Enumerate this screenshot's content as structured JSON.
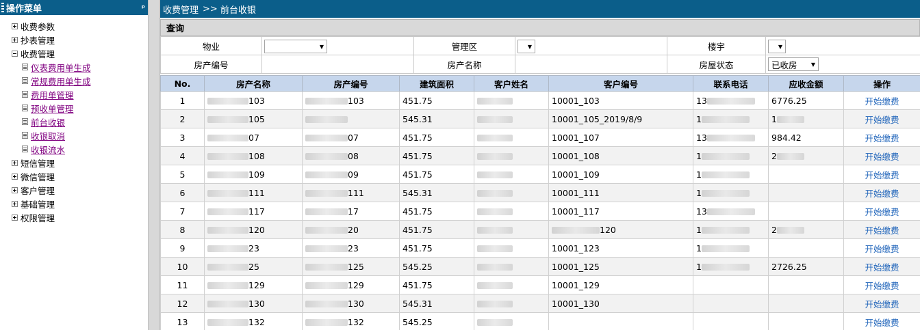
{
  "sidebar": {
    "title": "操作菜单",
    "pin_glyph": "ᵖ",
    "nodes": [
      {
        "label": "收费参数",
        "expanded": false
      },
      {
        "label": "抄表管理",
        "expanded": false
      },
      {
        "label": "收费管理",
        "expanded": true,
        "children": [
          "仪表费用单生成",
          "常规费用单生成",
          "费用单管理",
          "预收单管理",
          "前台收银",
          "收银取消",
          "收银流水"
        ]
      },
      {
        "label": "短信管理",
        "expanded": false
      },
      {
        "label": "微信管理",
        "expanded": false
      },
      {
        "label": "客户管理",
        "expanded": false
      },
      {
        "label": "基础管理",
        "expanded": false
      },
      {
        "label": "权限管理",
        "expanded": false
      }
    ]
  },
  "breadcrumb": {
    "section": "收费管理",
    "separator": ">>",
    "page": "前台收银"
  },
  "query": {
    "title": "查询",
    "labels": {
      "property": "物业",
      "district": "管理区",
      "building": "楼宇",
      "house_code": "房产编号",
      "house_name": "房产名称",
      "house_status": "房屋状态"
    },
    "values": {
      "property": "",
      "district": "",
      "building": "",
      "house_code": "",
      "house_name": "",
      "house_status": "已收房"
    }
  },
  "table": {
    "columns": [
      "No.",
      "房产名称",
      "房产编号",
      "建筑面积",
      "客户姓名",
      "客户编号",
      "联系电话",
      "应收金额",
      "操作"
    ],
    "action_label": "开始缴费",
    "rows": [
      {
        "no": "1",
        "name_suffix": "103",
        "code_suffix": "103",
        "area": "451.75",
        "cust_code": "10001_103",
        "phone_visible": "13",
        "amount": "6776.25"
      },
      {
        "no": "2",
        "name_suffix": "105",
        "code_suffix": "",
        "area": "545.31",
        "cust_code": "10001_105_2019/8/9",
        "phone_visible": "1",
        "amount": "1"
      },
      {
        "no": "3",
        "name_suffix": "07",
        "code_suffix": "07",
        "area": "451.75",
        "cust_code": "10001_107",
        "phone_visible": "13",
        "amount": "984.42"
      },
      {
        "no": "4",
        "name_suffix": "108",
        "code_suffix": "08",
        "area": "451.75",
        "cust_code": "10001_108",
        "phone_visible": "1",
        "amount": "2"
      },
      {
        "no": "5",
        "name_suffix": "109",
        "code_suffix": "09",
        "area": "451.75",
        "cust_code": "10001_109",
        "phone_visible": "1",
        "amount": ""
      },
      {
        "no": "6",
        "name_suffix": "111",
        "code_suffix": "111",
        "area": "545.31",
        "cust_code": "10001_111",
        "phone_visible": "1",
        "amount": ""
      },
      {
        "no": "7",
        "name_suffix": "117",
        "code_suffix": "17",
        "area": "451.75",
        "cust_code": "10001_117",
        "phone_visible": "13",
        "amount": ""
      },
      {
        "no": "8",
        "name_suffix": "120",
        "code_suffix": "20",
        "area": "451.75",
        "cust_code": "120",
        "phone_visible": "1",
        "amount": "2"
      },
      {
        "no": "9",
        "name_suffix": "23",
        "code_suffix": "23",
        "area": "451.75",
        "cust_code": "10001_123",
        "phone_visible": "1",
        "amount": ""
      },
      {
        "no": "10",
        "name_suffix": "25",
        "code_suffix": "125",
        "area": "545.25",
        "cust_code": "10001_125",
        "phone_visible": "1",
        "amount": "2726.25"
      },
      {
        "no": "11",
        "name_suffix": "129",
        "code_suffix": "129",
        "area": "451.75",
        "cust_code": "10001_129",
        "phone_visible": "",
        "amount": ""
      },
      {
        "no": "12",
        "name_suffix": "130",
        "code_suffix": "130",
        "area": "545.31",
        "cust_code": "10001_130",
        "phone_visible": "",
        "amount": ""
      },
      {
        "no": "13",
        "name_suffix": "132",
        "code_suffix": "132",
        "area": "545.25",
        "cust_code": "",
        "phone_visible": "",
        "amount": ""
      }
    ]
  }
}
